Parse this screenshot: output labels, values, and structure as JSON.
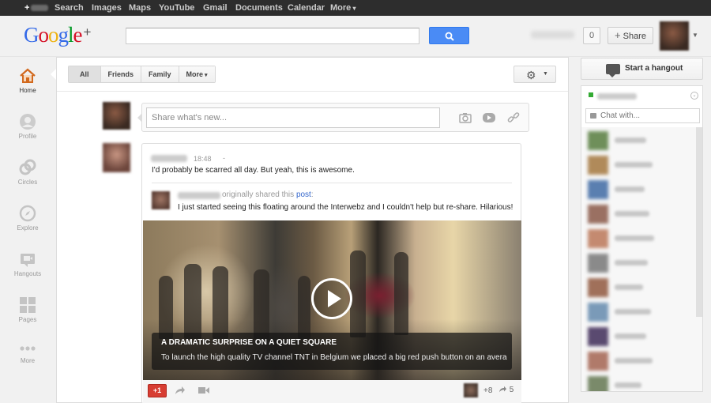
{
  "topbar": {
    "plus_label": "+",
    "items": [
      "Search",
      "Images",
      "Maps",
      "YouTube",
      "Gmail",
      "Documents",
      "Calendar",
      "More"
    ]
  },
  "header": {
    "logo": {
      "letters": [
        "G",
        "o",
        "o",
        "g",
        "l",
        "e"
      ],
      "plus": "+"
    },
    "notification_count": "0",
    "share_label": "Share",
    "share_plus": "+"
  },
  "leftnav": {
    "items": [
      {
        "label": "Home",
        "icon": "home-icon"
      },
      {
        "label": "Profile",
        "icon": "profile-icon"
      },
      {
        "label": "Circles",
        "icon": "circles-icon"
      },
      {
        "label": "Explore",
        "icon": "explore-icon"
      },
      {
        "label": "Hangouts",
        "icon": "hangouts-icon"
      },
      {
        "label": "Pages",
        "icon": "pages-icon"
      },
      {
        "label": "More",
        "icon": "more-dots-icon"
      }
    ]
  },
  "stream": {
    "filters": [
      "All",
      "Friends",
      "Family",
      "More"
    ],
    "sharebox_placeholder": "Share what's new...",
    "post": {
      "time": "18:48",
      "dash": "-",
      "text": "I'd probably be scarred all day. But yeah, this is awesome.",
      "shared_prefix": "originally shared this ",
      "shared_link": "post",
      "shared_suffix": ":",
      "original_text": "I just started seeing this floating around the Interwebz and I couldn't help but re-share. Hilarious!",
      "video": {
        "title": "A DRAMATIC SURPRISE ON A QUIET SQUARE",
        "description": "To launch the high quality TV channel TNT in Belgium we placed a big red push button on an averag…"
      },
      "plusone_label": "+1",
      "plus_count": "+8",
      "reshare_count": "5"
    }
  },
  "rightcol": {
    "hangout_label": "Start a hangout",
    "chat_placeholder": "Chat with...",
    "chat_toggle": "⌄"
  },
  "colors": {
    "topbar": "#2d2d2d",
    "search_button": "#4a8bf5",
    "plusone": "#d73d32",
    "link": "#3366cc",
    "online": "#33aa33"
  }
}
